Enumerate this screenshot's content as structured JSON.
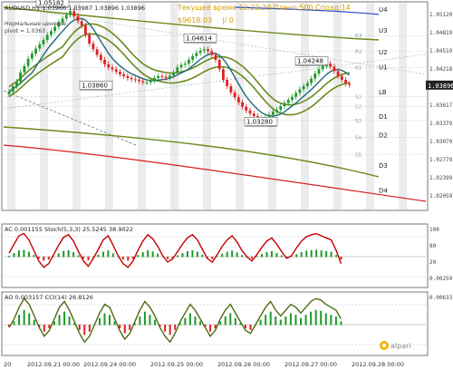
{
  "header": {
    "symbol_line": "AUDUSD,H1  1.03966 1.03987 1.03896 1.03896",
    "time_line": "Текущее время 12:22:29 Плечо:500 Спрэд:14",
    "balance": "$9618.03",
    "zero": "|/ 0",
    "note1": "Нормальные ценовое",
    "note2": "pivot = 1.0363",
    "high_label": "1.05182"
  },
  "logo": "alpari",
  "colors": {
    "bull": "#1f9a2b",
    "bear": "#e11f1f",
    "ma_olive": "#6b8a1c",
    "ma_teal": "#1d6b78",
    "ma_blue": "#2e49c9",
    "ma_red": "#d61e1e",
    "price_line": "#8a9a3a"
  },
  "chart_data": {
    "type": "candlestick",
    "symbol": "AUDUSD",
    "timeframe": "H1",
    "ylim": [
      1.0192,
      1.052
    ],
    "y_ticks": [
      "1.05120",
      "1.04819",
      "1.04519",
      "1.04218",
      "1.03918",
      "1.03617",
      "1.03379",
      "1.03079",
      "1.02779",
      "1.02399",
      "1.02059"
    ],
    "current_price": "1.03896",
    "current_price_value": 1.03896,
    "x_labels": [
      "20",
      "2012.09.21 00:00",
      "2012.09.24 00:00",
      "2012.09.25 00:00",
      "2012.09.26 00:00",
      "2012.09.27 00:00",
      "2012.09.28 00:00"
    ],
    "closes": [
      1.0379,
      1.0388,
      1.0395,
      1.041,
      1.042,
      1.0432,
      1.044,
      1.0448,
      1.0455,
      1.0462,
      1.047,
      1.0476,
      1.0483,
      1.049,
      1.0496,
      1.0502,
      1.0508,
      1.05,
      1.0492,
      1.0485,
      1.047,
      1.0456,
      1.0447,
      1.0438,
      1.043,
      1.0423,
      1.0418,
      1.0415,
      1.0411,
      1.0407,
      1.0404,
      1.0401,
      1.0399,
      1.0398,
      1.0396,
      1.0394,
      1.0394,
      1.0397,
      1.0401,
      1.0404,
      1.0403,
      1.0401,
      1.0405,
      1.041,
      1.0418,
      1.0422,
      1.0424,
      1.043,
      1.0436,
      1.0441,
      1.0445,
      1.0447,
      1.0444,
      1.0438,
      1.043,
      1.0415,
      1.0398,
      1.0388,
      1.0378,
      1.037,
      1.0362,
      1.0355,
      1.0349,
      1.0344,
      1.034,
      1.0336,
      1.0334,
      1.0338,
      1.0342,
      1.0347,
      1.035,
      1.0356,
      1.0361,
      1.0366,
      1.0371,
      1.0377,
      1.0383,
      1.0388,
      1.0393,
      1.04,
      1.0408,
      1.0415,
      1.042,
      1.0424,
      1.0419,
      1.0412,
      1.0404,
      1.0398,
      1.0392,
      1.039
    ],
    "price_labels": [
      {
        "text": "1.05182",
        "value": 1.05182
      },
      {
        "text": "1.04614",
        "value": 1.04614
      },
      {
        "text": "1.03860",
        "value": 1.0386
      },
      {
        "text": "1.04248",
        "value": 1.04248
      },
      {
        "text": "1.03280",
        "value": 1.0328
      }
    ],
    "levels": [
      {
        "name": "U4",
        "value": 1.0525
      },
      {
        "name": "U3",
        "value": 1.0478
      },
      {
        "name": "U2",
        "value": 1.0443
      },
      {
        "name": "U1",
        "value": 1.0419
      },
      {
        "name": "LB",
        "value": 1.0379
      },
      {
        "name": "D1",
        "value": 1.034
      },
      {
        "name": "D2",
        "value": 1.031
      },
      {
        "name": "D3",
        "value": 1.0262
      },
      {
        "name": "D4",
        "value": 1.0222
      }
    ],
    "inner_levels": [
      {
        "name": "R3",
        "value": 1.0469
      },
      {
        "name": "R2",
        "value": 1.0444
      },
      {
        "name": "R1",
        "value": 1.0418
      },
      {
        "name": "S1",
        "value": 1.0371
      },
      {
        "name": "S2",
        "value": 1.0355
      },
      {
        "name": "S3",
        "value": 1.0333
      },
      {
        "name": "S4",
        "value": 1.0306
      },
      {
        "name": "S5",
        "value": 1.0278
      }
    ],
    "indicators": [
      {
        "name": "AC",
        "title": "AC 0.001155 Stoch(5,3,3) 25.5245 38.9022",
        "ticks": [
          "100",
          "80",
          "20",
          "0.00259"
        ],
        "series_stoch": [
          55,
          72,
          88,
          92,
          80,
          60,
          40,
          28,
          35,
          52,
          70,
          85,
          90,
          78,
          58,
          40,
          30,
          45,
          62,
          80,
          88,
          70,
          50,
          35,
          28,
          40,
          60,
          78,
          90,
          82,
          68,
          50,
          38,
          44,
          58,
          72,
          84,
          90,
          80,
          62,
          45,
          38,
          52,
          68,
          80,
          88,
          76,
          60,
          48,
          40,
          52,
          66,
          78,
          84,
          72,
          58,
          45,
          50,
          65,
          78,
          86,
          90,
          92,
          88,
          84,
          80,
          60,
          35
        ]
      },
      {
        "name": "AO",
        "title": "AO 0.003157 CCI(14) 26.8126",
        "ticks": [
          "0.00633"
        ],
        "series_cci": [
          -10,
          20,
          60,
          90,
          70,
          30,
          -10,
          -40,
          -20,
          20,
          60,
          80,
          50,
          10,
          -30,
          -60,
          -40,
          0,
          40,
          70,
          60,
          20,
          -20,
          -50,
          -30,
          10,
          50,
          80,
          60,
          30,
          -10,
          -40,
          -60,
          -30,
          10,
          40,
          70,
          50,
          20,
          -10,
          -40,
          -20,
          20,
          50,
          70,
          40,
          10,
          -20,
          -30,
          0,
          30,
          60,
          80,
          50,
          30,
          50,
          70,
          60,
          40,
          60,
          80,
          90,
          85,
          70,
          60,
          50,
          20
        ]
      }
    ]
  }
}
